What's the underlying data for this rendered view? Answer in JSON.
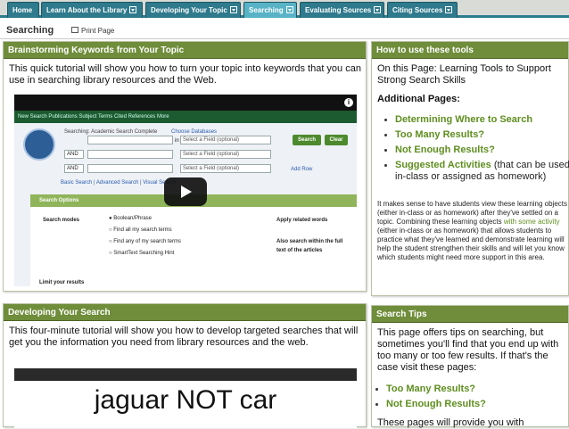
{
  "tabs": [
    "Home",
    "Learn About the Library",
    "Developing Your Topic",
    "Searching",
    "Evaluating Sources",
    "Citing Sources"
  ],
  "page": {
    "title": "Searching",
    "print_label": "Print Page"
  },
  "brainstorm": {
    "heading": "Brainstorming Keywords from Your Topic",
    "text": "This quick tutorial will show you how to turn your topic into keywords that you can use in searching  library resources and the Web."
  },
  "video1": {
    "nav": "New Search  Publications  Subject Terms  Cited References  More",
    "searching_label": "Searching: Academic Search Complete",
    "choose_db": "Choose Databases",
    "field_placeholder": "Select a Field (optional)",
    "search_btn": "Search",
    "clear_btn": "Clear",
    "and_label": "AND",
    "add_row": "Add Row",
    "basic_search": "Basic Search",
    "advanced_search": "Advanced Search",
    "visual_search": "Visual Search",
    "search_options": "Search Options",
    "search_modes": "Search modes",
    "modes": [
      "Boolean/Phrase",
      "Find all my search terms",
      "Find any of my search terms",
      "SmartText Searching Hint"
    ],
    "apply_related": "Apply related words",
    "also_search": "Also search within the full text of the articles",
    "limit_results": "Limit your results"
  },
  "howto": {
    "heading": "How to use these tools",
    "intro": "On this Page: Learning Tools to Support Strong Search Skills",
    "additional": "Additional Pages:",
    "links": [
      "Determining Where to Search",
      "Too Many Results?",
      "Not Enough Results?",
      "Suggested Activities"
    ],
    "activities_suffix": " (that can be used in-class or assigned as homework)",
    "para1": "It makes sense to have students view these learning objects (either in-class or as homework) after they've settled on a topic. Combining these learning objects ",
    "para_link": "with some activity",
    "para2": " (either in-class or as homework) that allows students to practice what they've learned and demonstrate learning will help the student strengthen their skills and will let you know which students might need more support in this area."
  },
  "developing": {
    "heading": "Developing Your Search",
    "text": "This four-minute tutorial will show you how to develop targeted searches that will get you the information you need from library resources and the web.",
    "video_text": "jaguar NOT car"
  },
  "tips": {
    "heading": "Search Tips",
    "text": "This page offers tips on searching, but sometimes you'll find that you end up with too many or too few results. If that's the case visit these pages:",
    "links": [
      "Too Many Results?",
      "Not Enough Results?"
    ],
    "footer": "These pages will provide you with"
  }
}
